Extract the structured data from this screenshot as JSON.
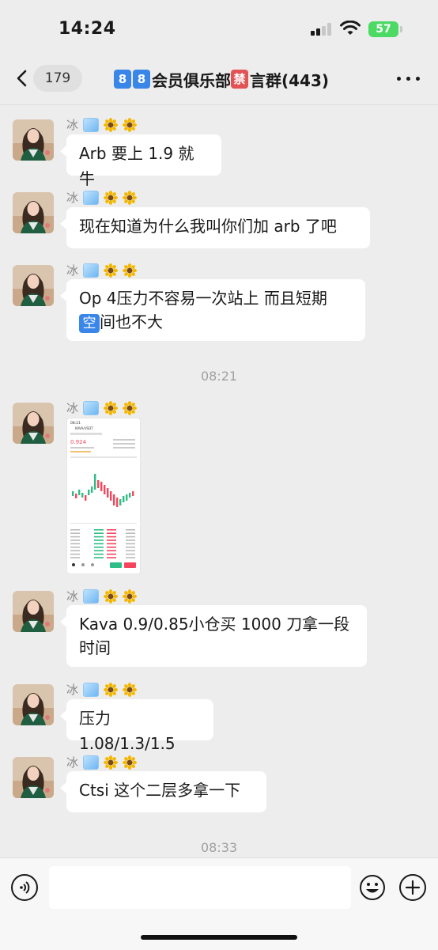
{
  "status_bar": {
    "time": "14:24",
    "battery": "57"
  },
  "nav": {
    "unread_count": "179",
    "title_prefix_1": "8",
    "title_prefix_2": "8",
    "title_main": "会员俱乐部",
    "title_ban": "禁",
    "title_suffix": "言群(443)"
  },
  "messages": [
    {
      "sender": "冰",
      "text": "Arb 要上 1.9 就牛"
    },
    {
      "sender": "冰",
      "text": "现在知道为什么我叫你们加 arb 了吧"
    },
    {
      "sender": "冰",
      "text_line1": "Op 4压力不容易一次站上 而且短期",
      "text_kong": "空",
      "text_line2": "间也不大"
    },
    {
      "timestamp": "08:21"
    },
    {
      "sender": "冰",
      "image": "kava-usdt-chart-screenshot",
      "screenshot": {
        "time": "08:21",
        "pair": "KAVA/USDT",
        "price": "0.924"
      }
    },
    {
      "sender": "冰",
      "text_line1": "Kava 0.9/0.85小仓买 1000 刀拿一段",
      "text_line2": "时间"
    },
    {
      "sender": "冰",
      "text": "压力 1.08/1.3/1.5"
    },
    {
      "sender": "冰",
      "text": "Ctsi 这个二层多拿一下"
    },
    {
      "timestamp": "08:33"
    }
  ],
  "colors": {
    "background": "#ededed",
    "bubble": "#ffffff",
    "accent_blue": "#3a86e8",
    "ban_red": "#e35353",
    "candle_up": "#2ebd85",
    "candle_down": "#f6465d"
  }
}
